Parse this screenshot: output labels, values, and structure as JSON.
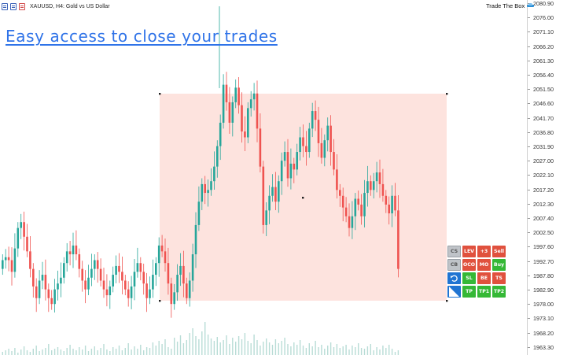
{
  "window": {
    "symbol_title": "XAUUSD, H4:  Gold vs US Dollar",
    "ea_name": "Trade The Box",
    "icons": [
      "chart-list-icon",
      "chart-properties-icon",
      "close-chart-icon",
      "graduation-cap-icon"
    ]
  },
  "headline": "Easy access to close your trades",
  "price_axis": {
    "labels": [
      "2080.90",
      "2076.00",
      "2071.10",
      "2066.20",
      "2061.30",
      "2056.40",
      "2051.50",
      "2046.60",
      "2041.70",
      "2036.80",
      "2031.90",
      "2027.00",
      "2022.10",
      "2017.20",
      "2012.30",
      "2007.40",
      "2002.50",
      "1997.60",
      "1992.70",
      "1987.80",
      "1982.90",
      "1978.00",
      "1973.10",
      "1968.20",
      "1963.30"
    ]
  },
  "colors": {
    "bull_candle": "#26a69a",
    "bear_candle": "#ef5350",
    "box_fill": "#fde3de",
    "volume": "#b8dcd6",
    "headline": "#2f73e8"
  },
  "panel": {
    "buttons": [
      {
        "label": "CS",
        "style": "grey",
        "name": "cs-button"
      },
      {
        "label": "LEV",
        "style": "red",
        "name": "leverage-button"
      },
      {
        "label": "+3",
        "style": "red",
        "name": "plus-three-button"
      },
      {
        "label": "Sell",
        "style": "red",
        "name": "sell-button"
      },
      {
        "label": "CB",
        "style": "grey",
        "name": "cb-button"
      },
      {
        "label": "OCO",
        "style": "red",
        "name": "oco-button"
      },
      {
        "label": "MO",
        "style": "red",
        "name": "mo-button"
      },
      {
        "label": "Buy",
        "style": "green",
        "name": "buy-button"
      },
      {
        "label": "",
        "style": "blue",
        "name": "undo-icon"
      },
      {
        "label": "SL",
        "style": "green",
        "name": "sl-button"
      },
      {
        "label": "BE",
        "style": "red",
        "name": "be-button"
      },
      {
        "label": "TS",
        "style": "red",
        "name": "ts-button"
      },
      {
        "label": "",
        "style": "blue",
        "name": "diagonal-box-icon"
      },
      {
        "label": "TP",
        "style": "green",
        "name": "tp-button"
      },
      {
        "label": "TP1",
        "style": "green",
        "name": "tp1-button"
      },
      {
        "label": "TP2",
        "style": "green",
        "name": "tp2-button"
      }
    ]
  }
}
